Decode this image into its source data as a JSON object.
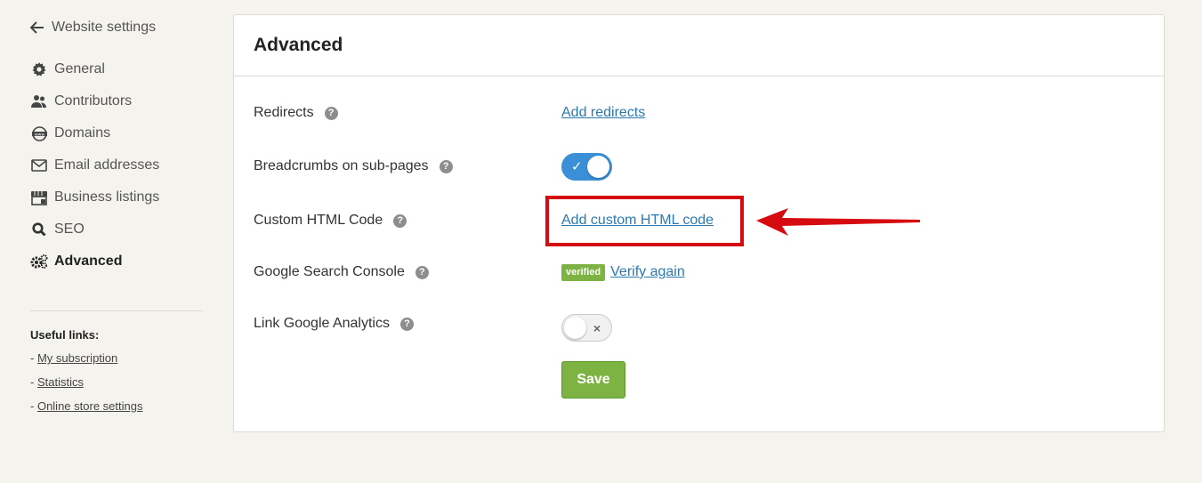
{
  "sidebar": {
    "back_label": "Website settings",
    "items": [
      {
        "label": "General",
        "icon": "gear-icon"
      },
      {
        "label": "Contributors",
        "icon": "users-icon"
      },
      {
        "label": "Domains",
        "icon": "www-globe-icon"
      },
      {
        "label": "Email addresses",
        "icon": "envelope-icon"
      },
      {
        "label": "Business listings",
        "icon": "storefront-icon"
      },
      {
        "label": "SEO",
        "icon": "search-icon"
      },
      {
        "label": "Advanced",
        "icon": "gears-icon",
        "active": true
      }
    ],
    "useful_links_title": "Useful links:",
    "useful_links": [
      {
        "label": "My subscription"
      },
      {
        "label": "Statistics"
      },
      {
        "label": "Online store settings"
      }
    ]
  },
  "main": {
    "title": "Advanced",
    "redirects": {
      "label": "Redirects",
      "link": "Add redirects"
    },
    "breadcrumbs": {
      "label": "Breadcrumbs on sub-pages",
      "enabled": true,
      "mark": "✓"
    },
    "custom_html": {
      "label": "Custom HTML Code",
      "link": "Add custom HTML code"
    },
    "search_console": {
      "label": "Google Search Console",
      "badge": "verified",
      "link": "Verify again"
    },
    "analytics": {
      "label": "Link Google Analytics",
      "enabled": false,
      "mark": "×"
    },
    "save_label": "Save",
    "help_glyph": "?"
  },
  "colors": {
    "background": "#f4f3ee",
    "link": "#2a7ab0",
    "toggle_on": "#3a8fd6",
    "save_green": "#7cb342",
    "annotation_red": "#d60b12"
  }
}
